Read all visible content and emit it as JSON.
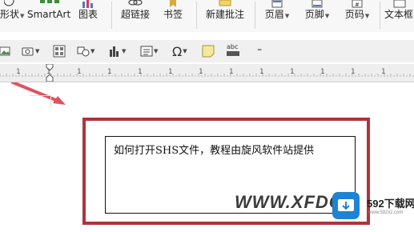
{
  "ribbon": {
    "items": [
      {
        "label": "形状",
        "has_dropdown": true,
        "icon": "shape-icon"
      },
      {
        "label": "SmartArt",
        "has_dropdown": false,
        "icon": "smartart-icon"
      },
      {
        "label": "图表",
        "has_dropdown": false,
        "icon": "chart-icon"
      },
      {
        "label": "超链接",
        "has_dropdown": false,
        "icon": "hyperlink-icon"
      },
      {
        "label": "书签",
        "has_dropdown": false,
        "icon": "bookmark-icon"
      },
      {
        "label": "新建批注",
        "has_dropdown": false,
        "icon": "new-comment-icon"
      },
      {
        "label": "页眉",
        "has_dropdown": true,
        "icon": "header-icon"
      },
      {
        "label": "页脚",
        "has_dropdown": true,
        "icon": "footer-icon"
      },
      {
        "label": "页码",
        "has_dropdown": true,
        "icon": "page-number-icon"
      },
      {
        "label": "文本框",
        "has_dropdown": false,
        "icon": "textbox-icon"
      }
    ],
    "dropdown_glyph": "▼"
  },
  "toolbar2": {
    "buttons": [
      {
        "icon": "picture-icon"
      },
      {
        "icon": "screenshot-icon"
      },
      {
        "icon": "object-icon"
      },
      {
        "icon": "shapes-icon"
      },
      {
        "icon": "bar-chart-icon"
      },
      {
        "icon": "textbox-small-icon"
      },
      {
        "icon": "symbol-icon",
        "glyph": "Ω"
      },
      {
        "icon": "sticky-note-icon"
      },
      {
        "icon": "word-art-icon",
        "glyph": "abc"
      },
      {
        "icon": "more-icon",
        "glyph": "⁼"
      }
    ]
  },
  "ruler": {
    "numbers": [
      "1",
      "1",
      "1",
      "1",
      "1",
      "1",
      "1",
      "1",
      "1",
      "1",
      "1",
      "1",
      "1",
      "1",
      "1",
      "1",
      "1",
      "1",
      "1",
      "1"
    ]
  },
  "document": {
    "textbox_text": "如何打开SHS文件，教程由旋风软件站提供",
    "watermark": "WWW.XFDC",
    "logo": {
      "text": "592下载网",
      "url": "www.592xz.com"
    }
  },
  "colors": {
    "accent_red": "#b0333a",
    "arrow_red": "#e05260",
    "logo_blue": "#1e83d4"
  }
}
